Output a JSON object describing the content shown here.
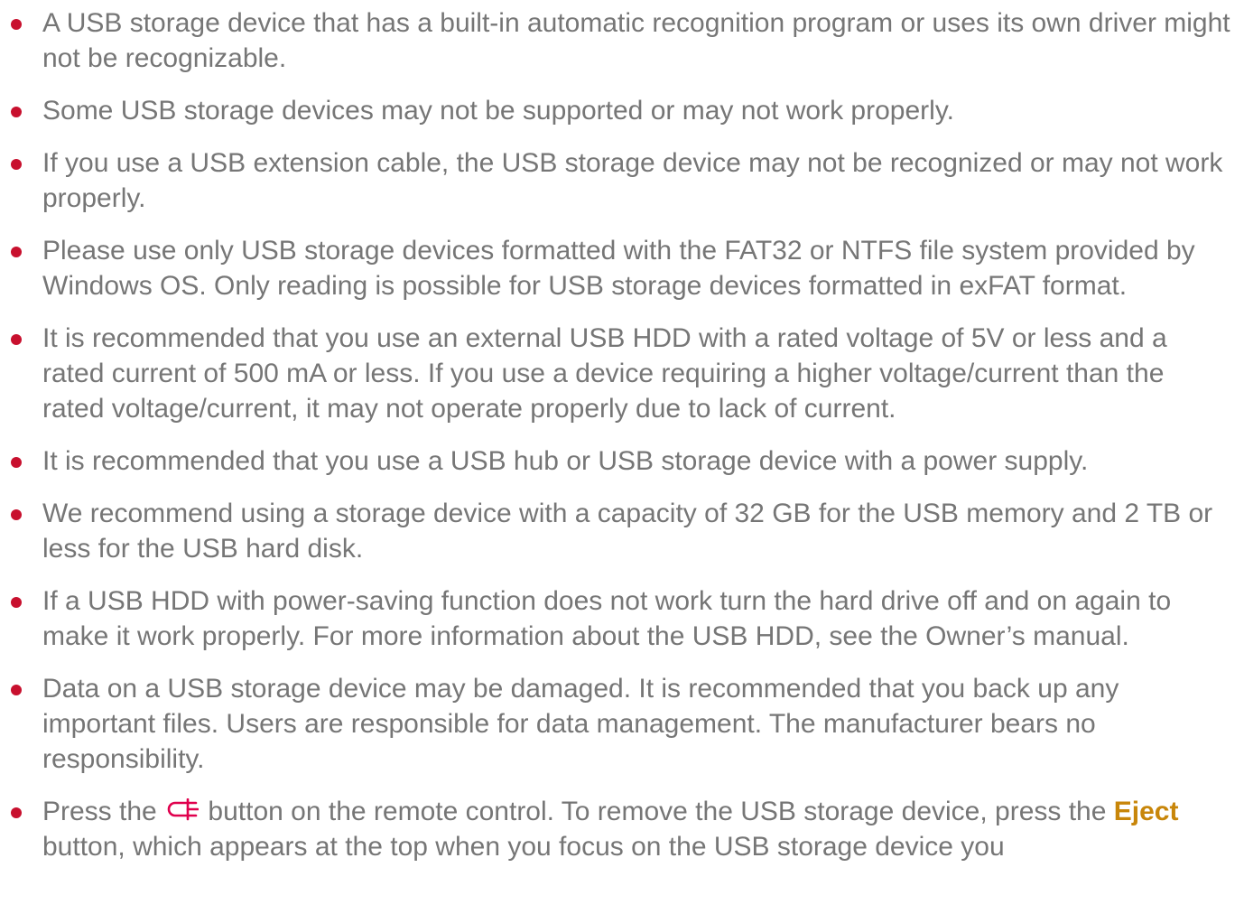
{
  "colors": {
    "bullet": "#c8102e",
    "text": "#767676",
    "keyword": "#c8860a",
    "icon": "#e0004d"
  },
  "items": [
    {
      "text": "A USB storage device that has a built-in automatic recognition program or uses its own driver might not be recognizable."
    },
    {
      "text": "Some USB storage devices may not be supported or may not work properly."
    },
    {
      "text": "If you use a USB extension cable, the USB storage device may not be recognized or may not work properly."
    },
    {
      "text": "Please use only USB storage devices formatted with the FAT32 or NTFS file system provided by Windows OS. Only reading is possible for USB storage devices formatted in exFAT format."
    },
    {
      "text": "It is recommended that you use an external USB HDD with a rated voltage of 5V or less and a rated current of 500 mA or less. If you use a device requiring a higher voltage/current than the rated voltage/current, it may not operate properly due to lack of current."
    },
    {
      "text": "It is recommended that you use a USB hub or USB storage device with a power supply."
    },
    {
      "text": "We recommend using a storage device with a capacity of 32 GB for the USB memory and 2 TB or less for the USB hard disk."
    },
    {
      "text": "If a USB HDD with power-saving function does not work turn the hard drive off and on again to make it work properly. For more information about the USB HDD, see the Owner’s manual."
    },
    {
      "text": "Data on a USB storage device may be damaged. It is recommended that you back up any important files. Users are responsible for data management. The manufacturer bears no responsibility."
    }
  ],
  "last_item": {
    "before_icon": "Press the",
    "icon": "usb-input-icon",
    "after_icon": "button on the remote control. To remove the USB storage device, press the",
    "keyword": "Eject",
    "after_keyword": "button, which appears at the top when you focus on the USB storage device you"
  }
}
